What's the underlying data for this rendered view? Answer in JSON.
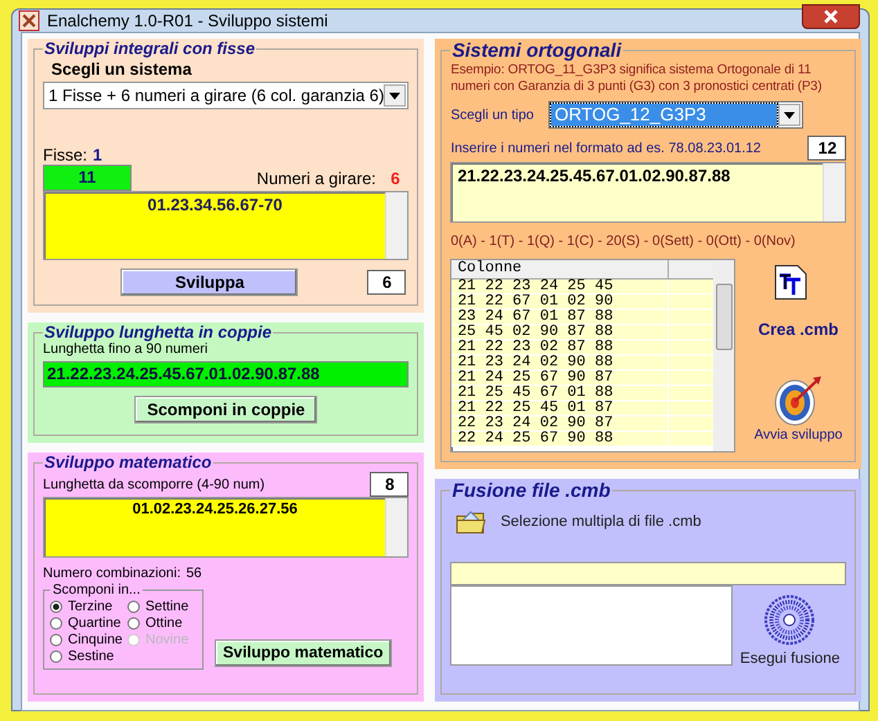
{
  "window": {
    "title": "Enalchemy 1.0-R01 - Sviluppo sistemi"
  },
  "integral": {
    "title": "Sviluppi integrali con fisse",
    "choose_label": "Scegli un sistema",
    "system": "1 Fisse + 6 numeri a girare (6 col. garanzia 6)",
    "fisse_label": "Fisse:",
    "fisse_count": "1",
    "fisse_value": "11",
    "turn_label": "Numeri a girare:",
    "turn_count": "6",
    "numbers": "01.23.34.56.67-70",
    "button": "Sviluppa",
    "columns": "6"
  },
  "pairs": {
    "title": "Sviluppo lunghetta in coppie",
    "label": "Lunghetta fino a 90 numeri",
    "value": "21.22.23.24.25.45.67.01.02.90.87.88",
    "button": "Scomponi in coppie"
  },
  "math": {
    "title": "Sviluppo matematico",
    "label": "Lunghetta da scomporre (4-90 num)",
    "count": "8",
    "numbers": "01.02.23.24.25.26.27.56",
    "combinations_label": "Numero combinazioni:",
    "combinations": "56",
    "group_title": "Scomponi in...",
    "options": [
      {
        "label": "Terzine",
        "selected": true,
        "disabled": false
      },
      {
        "label": "Quartine",
        "selected": false,
        "disabled": false
      },
      {
        "label": "Cinquine",
        "selected": false,
        "disabled": false
      },
      {
        "label": "Sestine",
        "selected": false,
        "disabled": false
      },
      {
        "label": "Settine",
        "selected": false,
        "disabled": false
      },
      {
        "label": "Ottine",
        "selected": false,
        "disabled": false
      },
      {
        "label": "Novine",
        "selected": false,
        "disabled": true
      }
    ],
    "button": "Sviluppo matematico"
  },
  "ortho": {
    "title": "Sistemi ortogonali",
    "example": "Esempio: ORTOG_11_G3P3 significa sistema Ortogonale di 11 numeri con Garanzia di 3 punti (G3) con 3 pronostici centrati (P3)",
    "type_label": "Scegli un tipo",
    "type_value": "ORTOG_12_G3P3",
    "input_label": "Inserire i numeri nel formato ad es. 78.08.23.01.12",
    "count": "12",
    "numbers": "21.22.23.24.25.45.67.01.02.90.87.88",
    "summary": "0(A) - 1(T) - 1(Q) - 1(C) - 20(S) - 0(Sett) - 0(Ott) - 0(Nov)",
    "table": {
      "column": "Colonne",
      "rows": [
        "21 22 23 24 25 45",
        "21 22 67 01 02 90",
        "23 24 67 01 87 88",
        "25 45 02 90 87 88",
        "21 22 23 02 87 88",
        "21 23 24 02 90 88",
        "21 24 25 67 90 87",
        "21 25 45 67 01 88",
        "21 22 25 45 01 87",
        "22 23 24 02 90 87",
        "22 24 25 67 90 88"
      ]
    },
    "create_label": "Crea .cmb",
    "start_label": "Avvia sviluppo"
  },
  "fusion": {
    "title": "Fusione file .cmb",
    "select_label": "Selezione multipla di file .cmb",
    "run_label": "Esegui fusione"
  }
}
